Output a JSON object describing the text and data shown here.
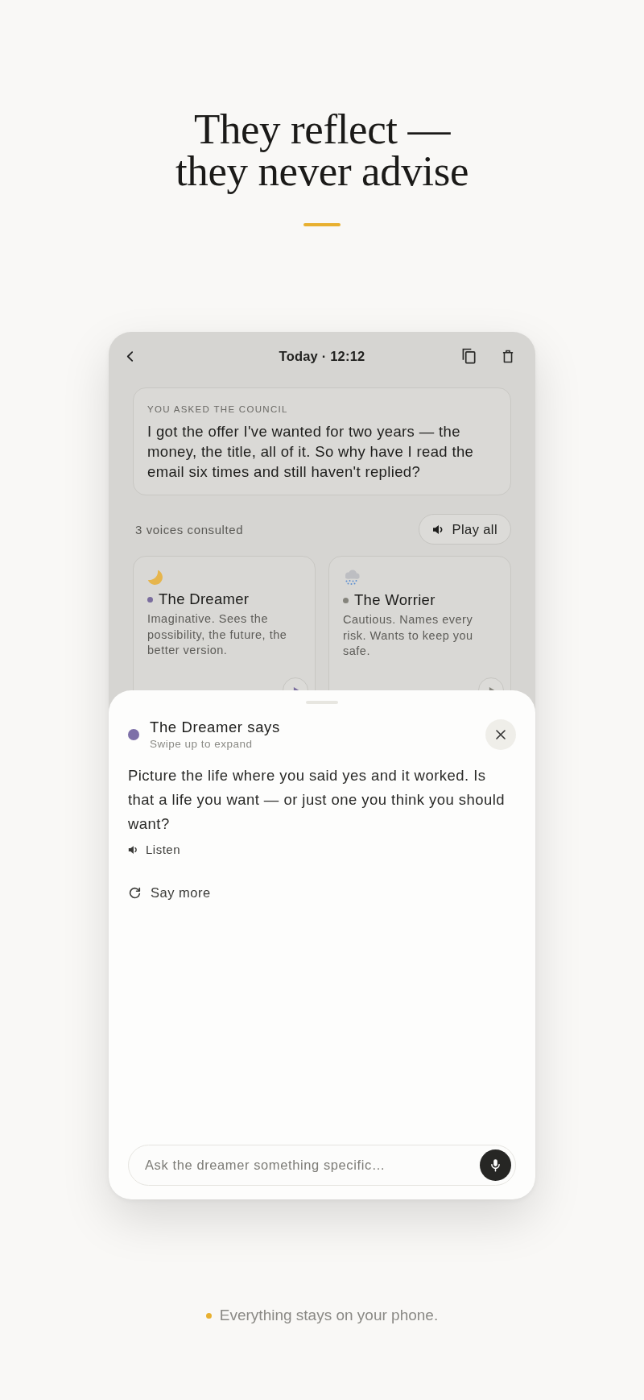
{
  "headline": {
    "lines": [
      "They reflect —",
      "they never advise"
    ]
  },
  "screen": {
    "header": {
      "title": "Today · 12:12"
    },
    "question": {
      "label": "YOU ASKED THE COUNCIL",
      "text": "I got the offer I've wanted for two years — the money, the title, all of it. So why have I read the email six times and still haven't replied?"
    },
    "voices_summary": {
      "count": "3 voices consulted",
      "play_all": "Play all"
    },
    "voices": [
      {
        "kind": "moon",
        "name": "The Dreamer",
        "description": "Imaginative. Sees the possibility, the future, the better version.",
        "color": "#7a6d9e"
      },
      {
        "kind": "cloud",
        "name": "The Worrier",
        "description": "Cautious. Names every risk. Wants to keep you safe.",
        "color": "#85847c"
      }
    ]
  },
  "sheet": {
    "speaker": "The Dreamer says",
    "hint": "Swipe up to expand",
    "color": "#7d70a8",
    "message": "Picture the life where you said yes and it worked. Is that a life you want — or just one you think you should want?",
    "listen": "Listen",
    "say_more": "Say more",
    "input": {
      "placeholder": "Ask the dreamer something specific…"
    }
  },
  "footer": {
    "text": "Everything stays on your phone."
  }
}
